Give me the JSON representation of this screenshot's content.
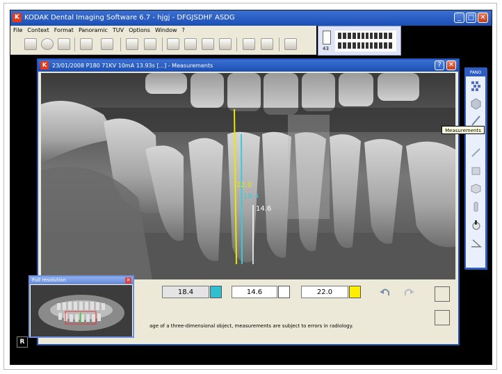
{
  "app": {
    "title": "KODAK Dental Imaging Software 6.7 - hjgj - DFGJSDHF ASDG",
    "logo_letter": "K"
  },
  "menu": [
    "File",
    "Context",
    "Format",
    "Panoramic",
    "TUV",
    "Options",
    "Window",
    "?"
  ],
  "thumbnail": {
    "number": "43"
  },
  "document": {
    "title": "23/01/2008 P180 71KV 10mA 13.93s [...] - Measurements"
  },
  "measurements": {
    "overlay": [
      {
        "label": "22.0",
        "color": "#e8e800"
      },
      {
        "label": "18.4",
        "color": "#40c8d8"
      },
      {
        "label": "14.6",
        "color": "#ffffff"
      }
    ],
    "boxes": [
      {
        "value": "18.4",
        "swatch": "#30c0d0"
      },
      {
        "value": "14.6",
        "swatch": "#ffffff"
      },
      {
        "value": "22.0",
        "swatch": "#ffee00"
      }
    ]
  },
  "note": "age of a three-dimensional object, measurements are subject to errors in radiology.",
  "right_panel": {
    "header": "PANO"
  },
  "tooltip": "Measurements",
  "full_resolution": {
    "title": "Full resolution"
  },
  "corner_badge": "R"
}
